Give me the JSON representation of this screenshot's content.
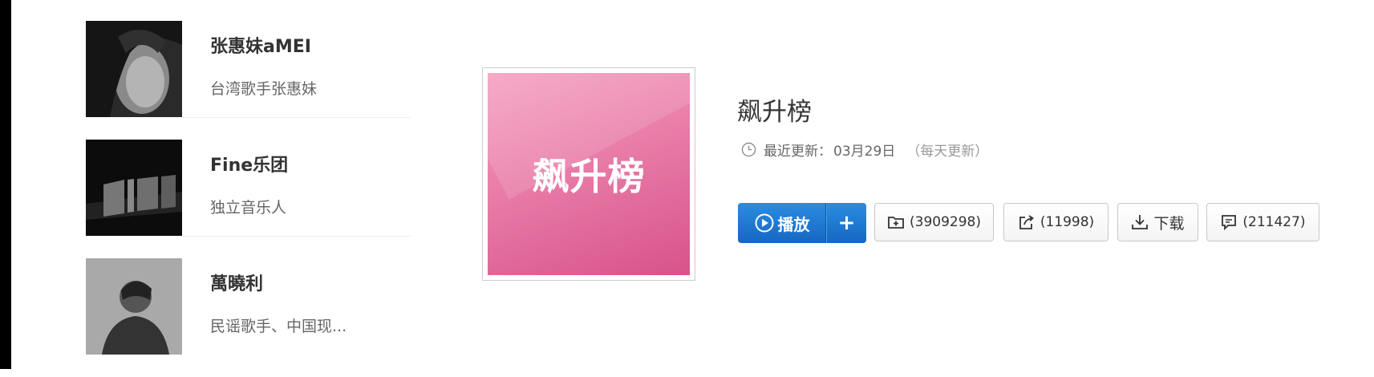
{
  "artists": [
    {
      "name": "张惠妹aMEI",
      "desc": "台湾歌手张惠妹"
    },
    {
      "name": "Fine乐团",
      "desc": "独立音乐人"
    },
    {
      "name": "萬曉利",
      "desc": "民谣歌手、中国现..."
    }
  ],
  "cover": {
    "text": "飙升榜"
  },
  "playlist": {
    "title": "飙升榜",
    "update_label": "最近更新：",
    "update_date": "03月29日",
    "update_freq": "（每天更新）"
  },
  "actions": {
    "play_label": "播放",
    "add_label": "+",
    "collect_count": "(3909298)",
    "share_count": "(11998)",
    "download_label": "下载",
    "comment_count": "(211427)"
  },
  "colors": {
    "primary": "#1a6fd0",
    "cover_pink": "#e47aa7"
  },
  "icons": [
    "clock-icon",
    "play-circle-icon",
    "add-folder-icon",
    "share-icon",
    "download-icon",
    "comment-icon"
  ]
}
